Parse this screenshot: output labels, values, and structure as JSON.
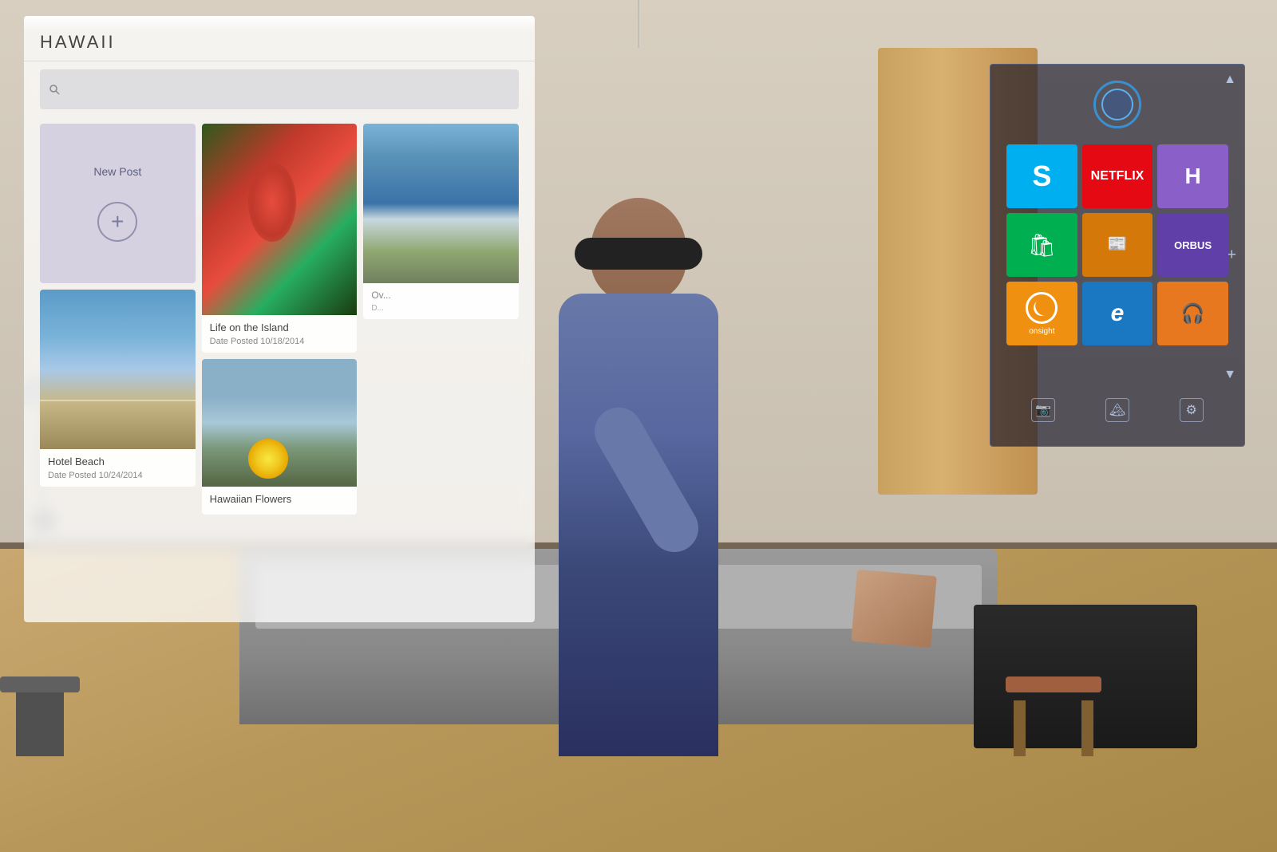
{
  "room": {
    "description": "Living room with HoloLens AR demonstration"
  },
  "blog_panel": {
    "title": "HAWAII",
    "new_post_label": "New Post",
    "posts": [
      {
        "id": "life-on-island",
        "title": "Life on the Island",
        "date": "Date Posted 10/18/2014",
        "image_type": "flower"
      },
      {
        "id": "hotel-beach",
        "title": "Hotel Beach",
        "date": "Date Posted 10/24/2014",
        "image_type": "beach"
      },
      {
        "id": "hawaiian-flowers",
        "title": "Hawaiian Flowers",
        "date": "",
        "image_type": "hawaiian"
      },
      {
        "id": "ocean-view",
        "title": "Ocean View",
        "date": "",
        "image_type": "ocean"
      }
    ],
    "partial_posts": [
      {
        "id": "partial-1",
        "title": "Ov...",
        "date": "D..."
      }
    ]
  },
  "start_panel": {
    "cortana_label": "Cortana",
    "tiles": [
      {
        "id": "skype",
        "label": "Skype",
        "color": "#00aff0",
        "icon": "S"
      },
      {
        "id": "netflix",
        "label": "NETFLIX",
        "color": "#e50914",
        "icon": "N"
      },
      {
        "id": "hololens-app",
        "label": "",
        "color": "#8a60c8",
        "icon": "H"
      },
      {
        "id": "store",
        "label": "Store",
        "color": "#00b050",
        "icon": "🛍"
      },
      {
        "id": "news",
        "label": "News",
        "color": "#d4780a",
        "icon": "📰"
      },
      {
        "id": "orbus",
        "label": "ORBUS",
        "color": "#6040a8",
        "icon": "O"
      },
      {
        "id": "onsight",
        "label": "onsight",
        "color": "#f09010",
        "icon": "⊙"
      },
      {
        "id": "internet-explorer",
        "label": "IE",
        "color": "#1a78c2",
        "icon": "e"
      },
      {
        "id": "music",
        "label": "Music",
        "color": "#e87820",
        "icon": "🎧"
      }
    ],
    "bottom_icons": [
      {
        "id": "camera",
        "label": "camera",
        "icon": "📷"
      },
      {
        "id": "landscape",
        "label": "landscape",
        "icon": "🏔"
      },
      {
        "id": "settings",
        "label": "settings",
        "icon": "⚙"
      }
    ],
    "nav": {
      "up": "▲",
      "down": "▼",
      "plus": "+"
    }
  }
}
